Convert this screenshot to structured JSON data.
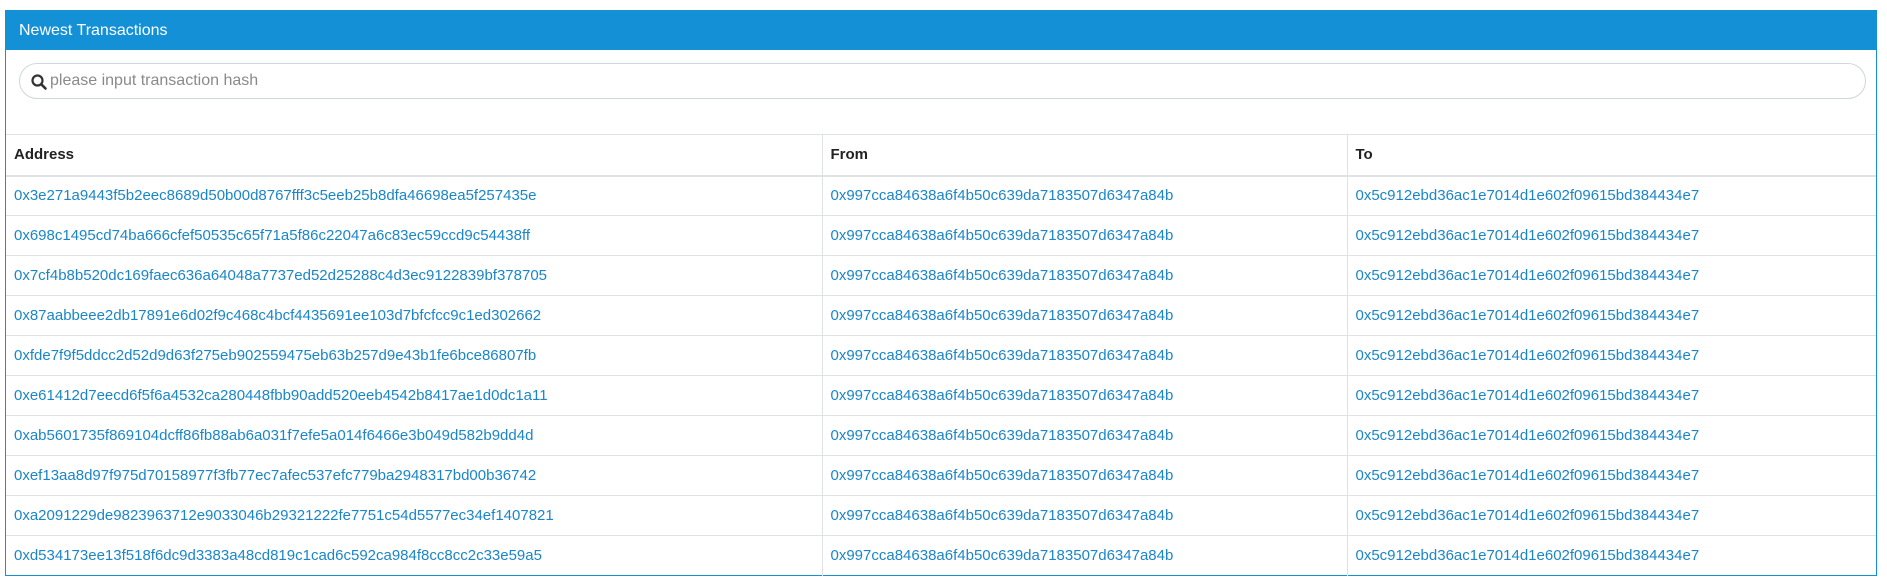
{
  "header": {
    "title": "Newest Transactions"
  },
  "search": {
    "placeholder": "please input transaction hash",
    "value": ""
  },
  "table": {
    "columns": [
      "Address",
      "From",
      "To"
    ],
    "rows": [
      {
        "address": "0x3e271a9443f5b2eec8689d50b00d8767fff3c5eeb25b8dfa46698ea5f257435e",
        "from": "0x997cca84638a6f4b50c639da7183507d6347a84b",
        "to": "0x5c912ebd36ac1e7014d1e602f09615bd384434e7"
      },
      {
        "address": "0x698c1495cd74ba666cfef50535c65f71a5f86c22047a6c83ec59ccd9c54438ff",
        "from": "0x997cca84638a6f4b50c639da7183507d6347a84b",
        "to": "0x5c912ebd36ac1e7014d1e602f09615bd384434e7"
      },
      {
        "address": "0x7cf4b8b520dc169faec636a64048a7737ed52d25288c4d3ec9122839bf378705",
        "from": "0x997cca84638a6f4b50c639da7183507d6347a84b",
        "to": "0x5c912ebd36ac1e7014d1e602f09615bd384434e7"
      },
      {
        "address": "0x87aabbeee2db17891e6d02f9c468c4bcf4435691ee103d7bfcfcc9c1ed302662",
        "from": "0x997cca84638a6f4b50c639da7183507d6347a84b",
        "to": "0x5c912ebd36ac1e7014d1e602f09615bd384434e7"
      },
      {
        "address": "0xfde7f9f5ddcc2d52d9d63f275eb902559475eb63b257d9e43b1fe6bce86807fb",
        "from": "0x997cca84638a6f4b50c639da7183507d6347a84b",
        "to": "0x5c912ebd36ac1e7014d1e602f09615bd384434e7"
      },
      {
        "address": "0xe61412d7eecd6f5f6a4532ca280448fbb90add520eeb4542b8417ae1d0dc1a11",
        "from": "0x997cca84638a6f4b50c639da7183507d6347a84b",
        "to": "0x5c912ebd36ac1e7014d1e602f09615bd384434e7"
      },
      {
        "address": "0xab5601735f869104dcff86fb88ab6a031f7efe5a014f6466e3b049d582b9dd4d",
        "from": "0x997cca84638a6f4b50c639da7183507d6347a84b",
        "to": "0x5c912ebd36ac1e7014d1e602f09615bd384434e7"
      },
      {
        "address": "0xef13aa8d97f975d70158977f3fb77ec7afec537efc779ba2948317bd00b36742",
        "from": "0x997cca84638a6f4b50c639da7183507d6347a84b",
        "to": "0x5c912ebd36ac1e7014d1e602f09615bd384434e7"
      },
      {
        "address": "0xa2091229de9823963712e9033046b29321222fe7751c54d5577ec34ef1407821",
        "from": "0x997cca84638a6f4b50c639da7183507d6347a84b",
        "to": "0x5c912ebd36ac1e7014d1e602f09615bd384434e7"
      },
      {
        "address": "0xd534173ee13f518f6dc9d3383a48cd819c1cad6c592ca984f8cc8cc2c33e59a5",
        "from": "0x997cca84638a6f4b50c639da7183507d6347a84b",
        "to": "0x5c912ebd36ac1e7014d1e602f09615bd384434e7"
      }
    ]
  },
  "colors": {
    "header_bg": "#1390d6",
    "link": "#1a86c8",
    "border": "#dee2e6"
  },
  "icons": {
    "search": "search-icon"
  }
}
